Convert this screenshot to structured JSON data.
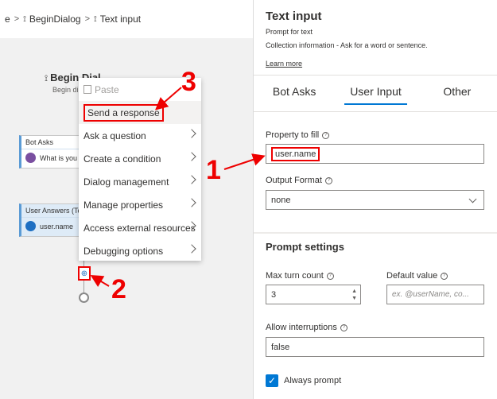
{
  "breadcrumb": {
    "item1": "e",
    "item2": "BeginDialog",
    "item3": "Text input"
  },
  "canvas": {
    "trigger_title": "Begin Dial",
    "trigger_sub": "Begin di",
    "node_bot_asks": {
      "header": "Bot Asks",
      "body": "What is you"
    },
    "node_user_answers": {
      "header": "User Answers (Te",
      "body": "user.name"
    }
  },
  "context_menu": {
    "items": [
      {
        "label": "Paste",
        "disabled": true
      },
      {
        "label": "Send a response"
      },
      {
        "label": "Ask a question"
      },
      {
        "label": "Create a condition"
      },
      {
        "label": "Dialog management"
      },
      {
        "label": "Manage properties"
      },
      {
        "label": "Access external resources"
      },
      {
        "label": "Debugging options"
      }
    ]
  },
  "annotations": {
    "one": "1",
    "two": "2",
    "three": "3"
  },
  "panel": {
    "title": "Text input",
    "subtitle": "Prompt for text",
    "description": "Collection information - Ask for a word or sentence.",
    "learn_more": "Learn more",
    "tabs": [
      "Bot Asks",
      "User Input",
      "Other"
    ],
    "active_tab": "User Input",
    "property_label": "Property to fill",
    "property_value": "user.name",
    "output_label": "Output Format",
    "output_value": "none",
    "prompt_settings": "Prompt settings",
    "max_turn_label": "Max turn count",
    "max_turn_value": "3",
    "default_label": "Default value",
    "default_placeholder": "ex. @userName, co...",
    "interrupt_label": "Allow interruptions",
    "interrupt_value": "false",
    "always_prompt_label": "Always prompt"
  },
  "colors": {
    "accent": "#0078d4",
    "annotation": "#e00000"
  }
}
